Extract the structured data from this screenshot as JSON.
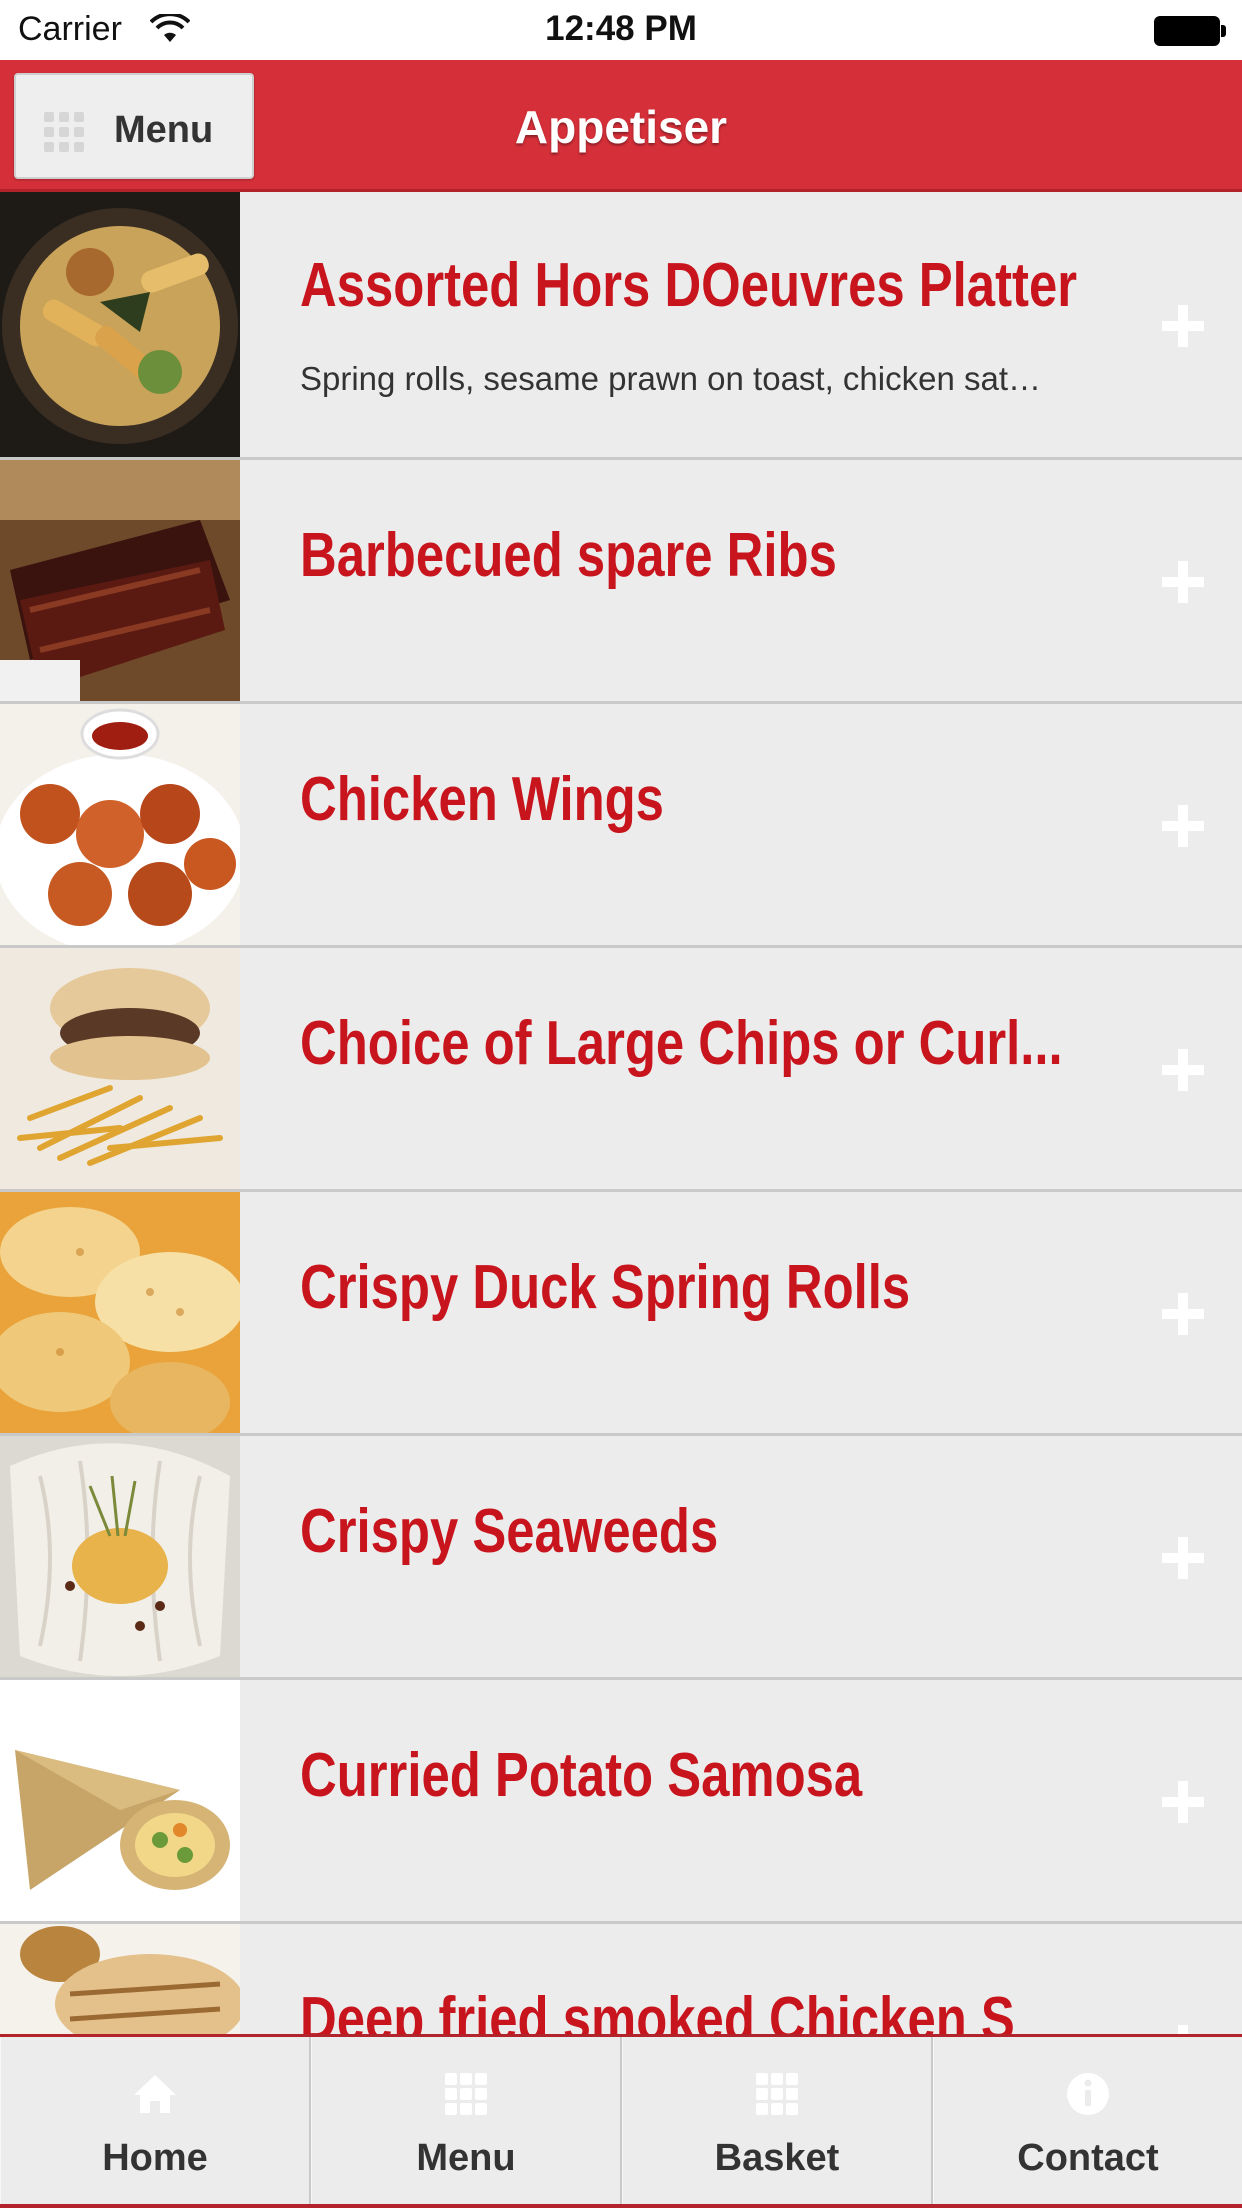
{
  "status_bar": {
    "carrier": "Carrier",
    "time": "12:48 PM"
  },
  "header": {
    "menu_label": "Menu",
    "title": "Appetiser"
  },
  "items": [
    {
      "title": "Assorted Hors DOeuvres Platter",
      "description": "Spring rolls, sesame prawn on toast, chicken sat…",
      "image": "food-platter-icon"
    },
    {
      "title": "Barbecued spare Ribs",
      "description": "",
      "image": "ribs-icon"
    },
    {
      "title": "Chicken Wings",
      "description": "",
      "image": "chicken-wings-icon"
    },
    {
      "title": "Choice of Large Chips or Curl...",
      "description": "",
      "image": "chips-icon"
    },
    {
      "title": "Crispy Duck Spring Rolls",
      "description": "",
      "image": "spring-rolls-icon"
    },
    {
      "title": "Crispy Seaweeds",
      "description": "",
      "image": "seaweed-icon"
    },
    {
      "title": "Curried Potato Samosa",
      "description": "",
      "image": "samosa-icon"
    },
    {
      "title": "Deep fried smoked Chicken S",
      "description": "",
      "image": "chicken-icon"
    }
  ],
  "tabs": [
    {
      "label": "Home",
      "icon": "home-icon"
    },
    {
      "label": "Menu",
      "icon": "grid-icon"
    },
    {
      "label": "Basket",
      "icon": "grid-icon"
    },
    {
      "label": "Contact",
      "icon": "info-icon"
    }
  ],
  "colors": {
    "header": "#d52f39",
    "title_red": "#c8141d",
    "background": "#ececec"
  }
}
